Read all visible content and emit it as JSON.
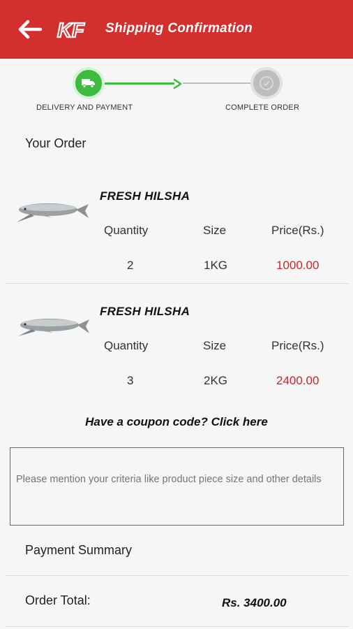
{
  "colors": {
    "appbar": "#d32f2f",
    "step_active": "#3dbb3d",
    "step_inactive": "#bdbdbd",
    "price": "#c62828"
  },
  "appbar": {
    "logo_text": "KF",
    "title": "Shipping Confirmation",
    "back_icon": "arrow-left-icon"
  },
  "stepper": {
    "steps": [
      {
        "label": "DELIVERY AND PAYMENT",
        "icon": "truck-icon",
        "state": "active"
      },
      {
        "label": "COMPLETE ORDER",
        "icon": "check-circle-icon",
        "state": "pending"
      }
    ]
  },
  "order": {
    "heading": "Your Order",
    "headers": {
      "quantity": "Quantity",
      "size": "Size",
      "price": "Price(Rs.)"
    },
    "items": [
      {
        "name": "FRESH HILSHA",
        "quantity": "2",
        "size": "1KG",
        "price": "1000.00",
        "image": "hilsha-fish-image"
      },
      {
        "name": "FRESH HILSHA",
        "quantity": "3",
        "size": "2KG",
        "price": "2400.00",
        "image": "hilsha-fish-image"
      }
    ]
  },
  "coupon": {
    "label": "Have a coupon code? Click here"
  },
  "notes": {
    "placeholder": "Please mention your criteria like product piece size and other details",
    "value": ""
  },
  "payment": {
    "heading": "Payment Summary",
    "total_label": "Order Total:",
    "total_value": "Rs. 3400.00"
  }
}
